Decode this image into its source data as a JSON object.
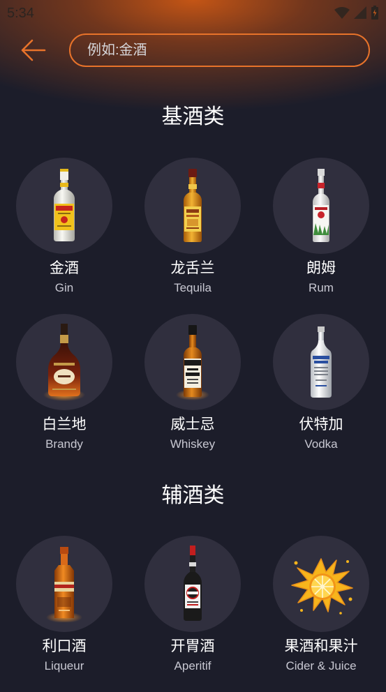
{
  "status_bar": {
    "time": "5:34",
    "icons": [
      "wifi-icon",
      "signal-icon",
      "battery-icon"
    ]
  },
  "header": {
    "back_icon": "back-arrow-icon",
    "search_placeholder": "例如:金酒"
  },
  "sections": [
    {
      "title": "基酒类",
      "items": [
        {
          "name_cn": "金酒",
          "name_en": "Gin",
          "icon": "gin-bottle-icon"
        },
        {
          "name_cn": "龙舌兰",
          "name_en": "Tequila",
          "icon": "tequila-bottle-icon"
        },
        {
          "name_cn": "朗姆",
          "name_en": "Rum",
          "icon": "rum-bottle-icon"
        },
        {
          "name_cn": "白兰地",
          "name_en": "Brandy",
          "icon": "brandy-bottle-icon"
        },
        {
          "name_cn": "威士忌",
          "name_en": "Whiskey",
          "icon": "whiskey-bottle-icon"
        },
        {
          "name_cn": "伏特加",
          "name_en": "Vodka",
          "icon": "vodka-bottle-icon"
        }
      ]
    },
    {
      "title": "辅酒类",
      "items": [
        {
          "name_cn": "利口酒",
          "name_en": "Liqueur",
          "icon": "liqueur-bottle-icon"
        },
        {
          "name_cn": "开胃酒",
          "name_en": "Aperitif",
          "icon": "aperitif-bottle-icon"
        },
        {
          "name_cn": "果酒和果汁",
          "name_en": "Cider & Juice",
          "icon": "juice-splash-icon"
        }
      ]
    }
  ],
  "colors": {
    "background": "#1c1d2a",
    "circle": "#302f3e",
    "accent": "#e8732a",
    "header_glow": "#cd5814",
    "text_primary": "#ffffff",
    "text_secondary": "#c8c8d2"
  }
}
